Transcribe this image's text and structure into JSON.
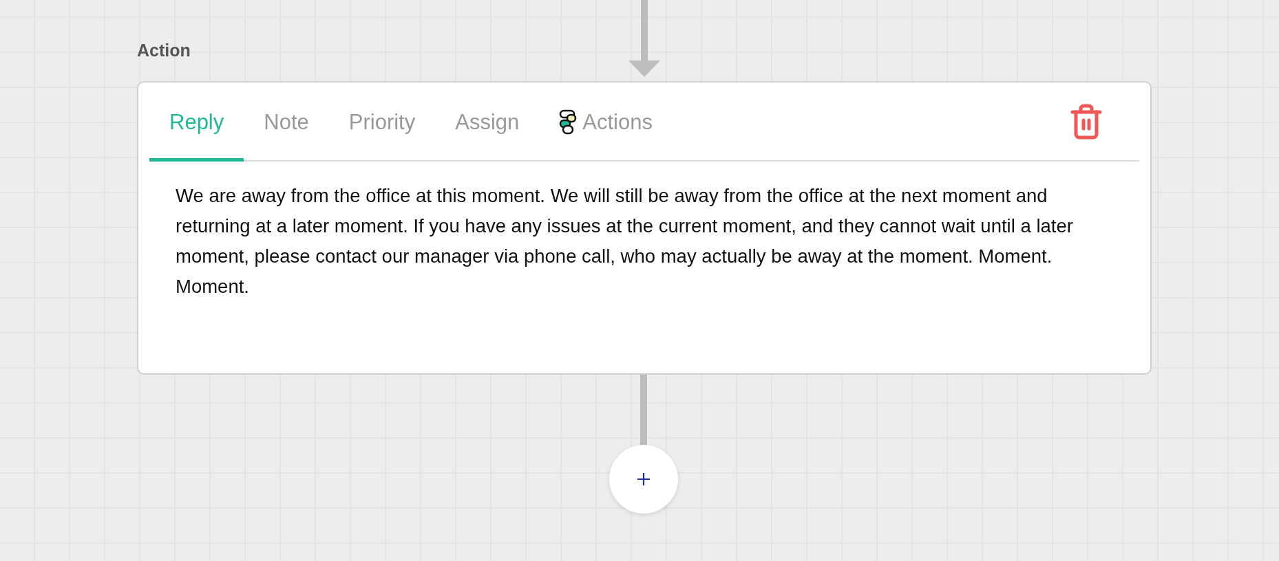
{
  "section_label": "Action",
  "tabs": [
    {
      "label": "Reply",
      "selected": true,
      "kind": "plain"
    },
    {
      "label": "Note",
      "selected": false,
      "kind": "plain"
    },
    {
      "label": "Priority",
      "selected": false,
      "kind": "plain"
    },
    {
      "label": "Assign",
      "selected": false,
      "kind": "plain"
    },
    {
      "label": "Actions",
      "selected": false,
      "kind": "integration"
    }
  ],
  "message": "We are away from the office at this moment. We will still be away from the office at the next moment and returning at a later moment. If you have any issues at the current moment, and they cannot wait until a later moment, please contact our manager via phone call, who may actually be away at the moment. Moment. Moment."
}
